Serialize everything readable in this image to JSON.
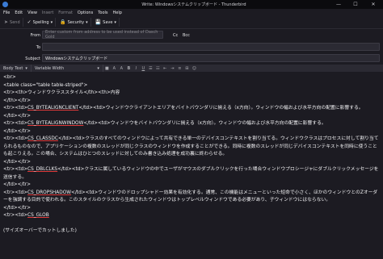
{
  "window": {
    "title": "Write: Windowsシステムクリップボード - Thunderbird",
    "minimize": "—",
    "maximize": "☐",
    "close": "✕"
  },
  "menubar": {
    "items": [
      "File",
      "Edit",
      "View",
      "Insert",
      "Format",
      "Options",
      "Tools",
      "Help"
    ]
  },
  "toolbar": {
    "send": "Send",
    "spelling": "Spelling",
    "security": "Security",
    "save": "Save"
  },
  "header": {
    "from_label": "From",
    "from_placeholder": "Enter custom from address to be used instead of Dasch Gold",
    "cc": "Cc",
    "bcc": "Bcc",
    "to_label": "To",
    "subject_label": "Subject",
    "subject_value": "Windowsシステムクリップボード"
  },
  "format": {
    "paragraph": "Body Text",
    "font": "Variable Width"
  },
  "body": {
    "l01": "<br>",
    "l02": "<table class=\"table table-striped\">",
    "l03": "<tr><th>ウィンドウクラススタイル</th><th>内容",
    "l04": "</th></tr>",
    "l05a": "<tr><td>",
    "l05b": "CS_BYTEALIGNCLIENT",
    "l05c": "</td><td>ウィンドウクライアントエリアをバイトバウンダリに揃える（x方向）。ウィンドウの幅および水平方向の配置に影響する。",
    "l06": "</td></tr>",
    "l07a": "<tr><td>",
    "l07b": "CS_BYTEALIGNWINDOW",
    "l07c": "</td><td>ウィンドウをバイトバウンダリに揃える（x方向）。ウィンドウの幅および水平方向の配置に影響する。",
    "l08": "</td></tr>",
    "l09a": "<tr><td>",
    "l09b": "CS_CLASSDC",
    "l09c": "</td><td>クラスのすべてのウィンドウによって共有できる単一のデバイスコンテキストを割り当てる。ウィンドウクラスはプロセスに対して割り当てられるものなので、アプリケーションの複数のスレッドが同じクラスのウィンドウを作成することができる。同時に複数のスレッドが同じデバイスコンテキストを同時に使うことも起こりえる。この場合、システムはひとつのスレッドに対してのみ書き込み処理を成功裏に終わらせる。",
    "l10": "</td></tr>",
    "l11a": "<tr><td>",
    "l11b": "CS_DBLCLKS",
    "l11c": "</td><td>クラスに属しているウィンドウの中でユーザがマウスのダブルクリックを行った場合ウィンドウプロシージャにダブルクリックメッセージを送信する。",
    "l12": "</td></tr>",
    "l13a": "<tr><td>",
    "l13b": "CS_DROPSHADOW",
    "l13c": "</td><td>ウィンドウのドロップシャドー効果を有効化する。通常、この機能はメニューといった短命で小さく、ほかのウィンドウとのZオーダーを強調する目的で使われる。このスタイルのクラスから生成されたウィンドウはトップレベルウィンドウである必要があり、子ウィンドウにはならない。",
    "l14": "</td></tr>",
    "l15a": "<tr><td>",
    "l15b": "CS_GLOB",
    "l16": "(サイズオーバーでカットしました)"
  }
}
